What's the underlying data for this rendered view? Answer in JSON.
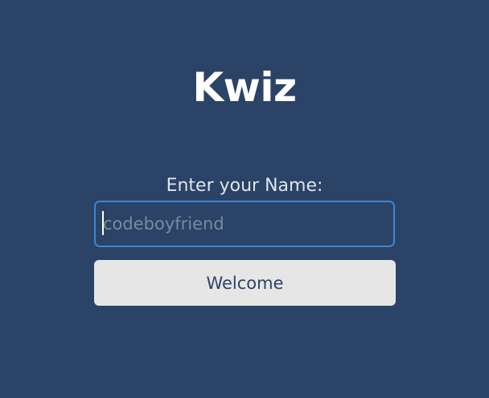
{
  "app": {
    "title": "Kwiz"
  },
  "form": {
    "name_label": "Enter your Name:",
    "name_value": "",
    "name_placeholder": "codeboyfriend",
    "submit_label": "Welcome"
  },
  "colors": {
    "background": "#2b4366",
    "title_text": "#ffffff",
    "label_text": "#dfe5ee",
    "input_focus_border": "#3b86d6",
    "placeholder_text": "#7a8aa3",
    "button_background": "#e6e6e6",
    "button_text": "#2b4366"
  }
}
